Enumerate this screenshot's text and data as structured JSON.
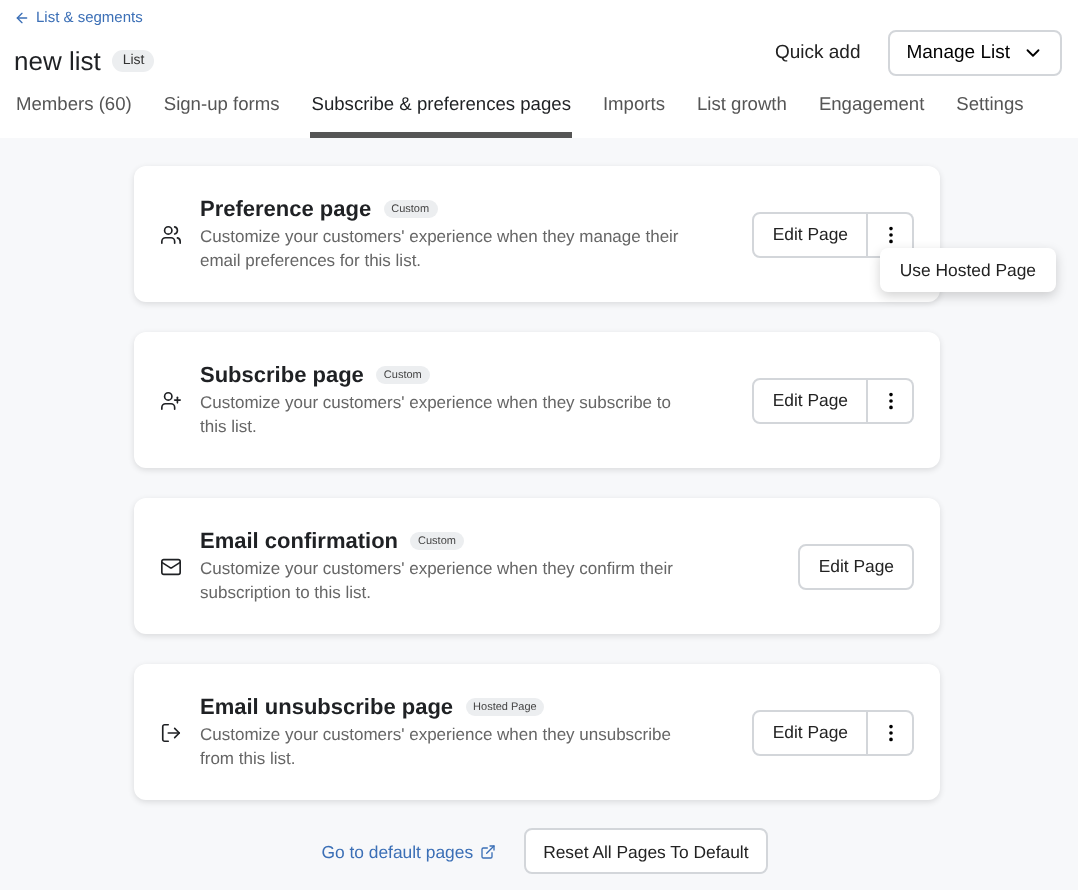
{
  "back_link": "List & segments",
  "title": "new list",
  "title_badge": "List",
  "actions": {
    "quick_add": "Quick add",
    "manage": "Manage List"
  },
  "tabs": [
    {
      "label": "Members (60)",
      "selected": false
    },
    {
      "label": "Sign-up forms",
      "selected": false
    },
    {
      "label": "Subscribe & preferences pages",
      "selected": true
    },
    {
      "label": "Imports",
      "selected": false
    },
    {
      "label": "List growth",
      "selected": false
    },
    {
      "label": "Engagement",
      "selected": false
    },
    {
      "label": "Settings",
      "selected": false
    }
  ],
  "cards": [
    {
      "title": "Preference page",
      "badge": "Custom",
      "description": "Customize your customers' experience when they manage their email preferences for this list.",
      "button": "Edit Page",
      "has_more": true,
      "menu": [
        "Use Hosted Page"
      ]
    },
    {
      "title": "Subscribe page",
      "badge": "Custom",
      "description": "Customize your customers' experience when they subscribe to this list.",
      "button": "Edit Page",
      "has_more": true
    },
    {
      "title": "Email confirmation",
      "badge": "Custom",
      "description": "Customize your customers' experience when they confirm their subscription to this list.",
      "button": "Edit Page",
      "has_more": false
    },
    {
      "title": "Email unsubscribe page",
      "badge": "Hosted Page",
      "description": "Customize your customers' experience when they unsubscribe from this list.",
      "button": "Edit Page",
      "has_more": true
    }
  ],
  "footer": {
    "link": "Go to default pages",
    "reset": "Reset All Pages To Default"
  }
}
